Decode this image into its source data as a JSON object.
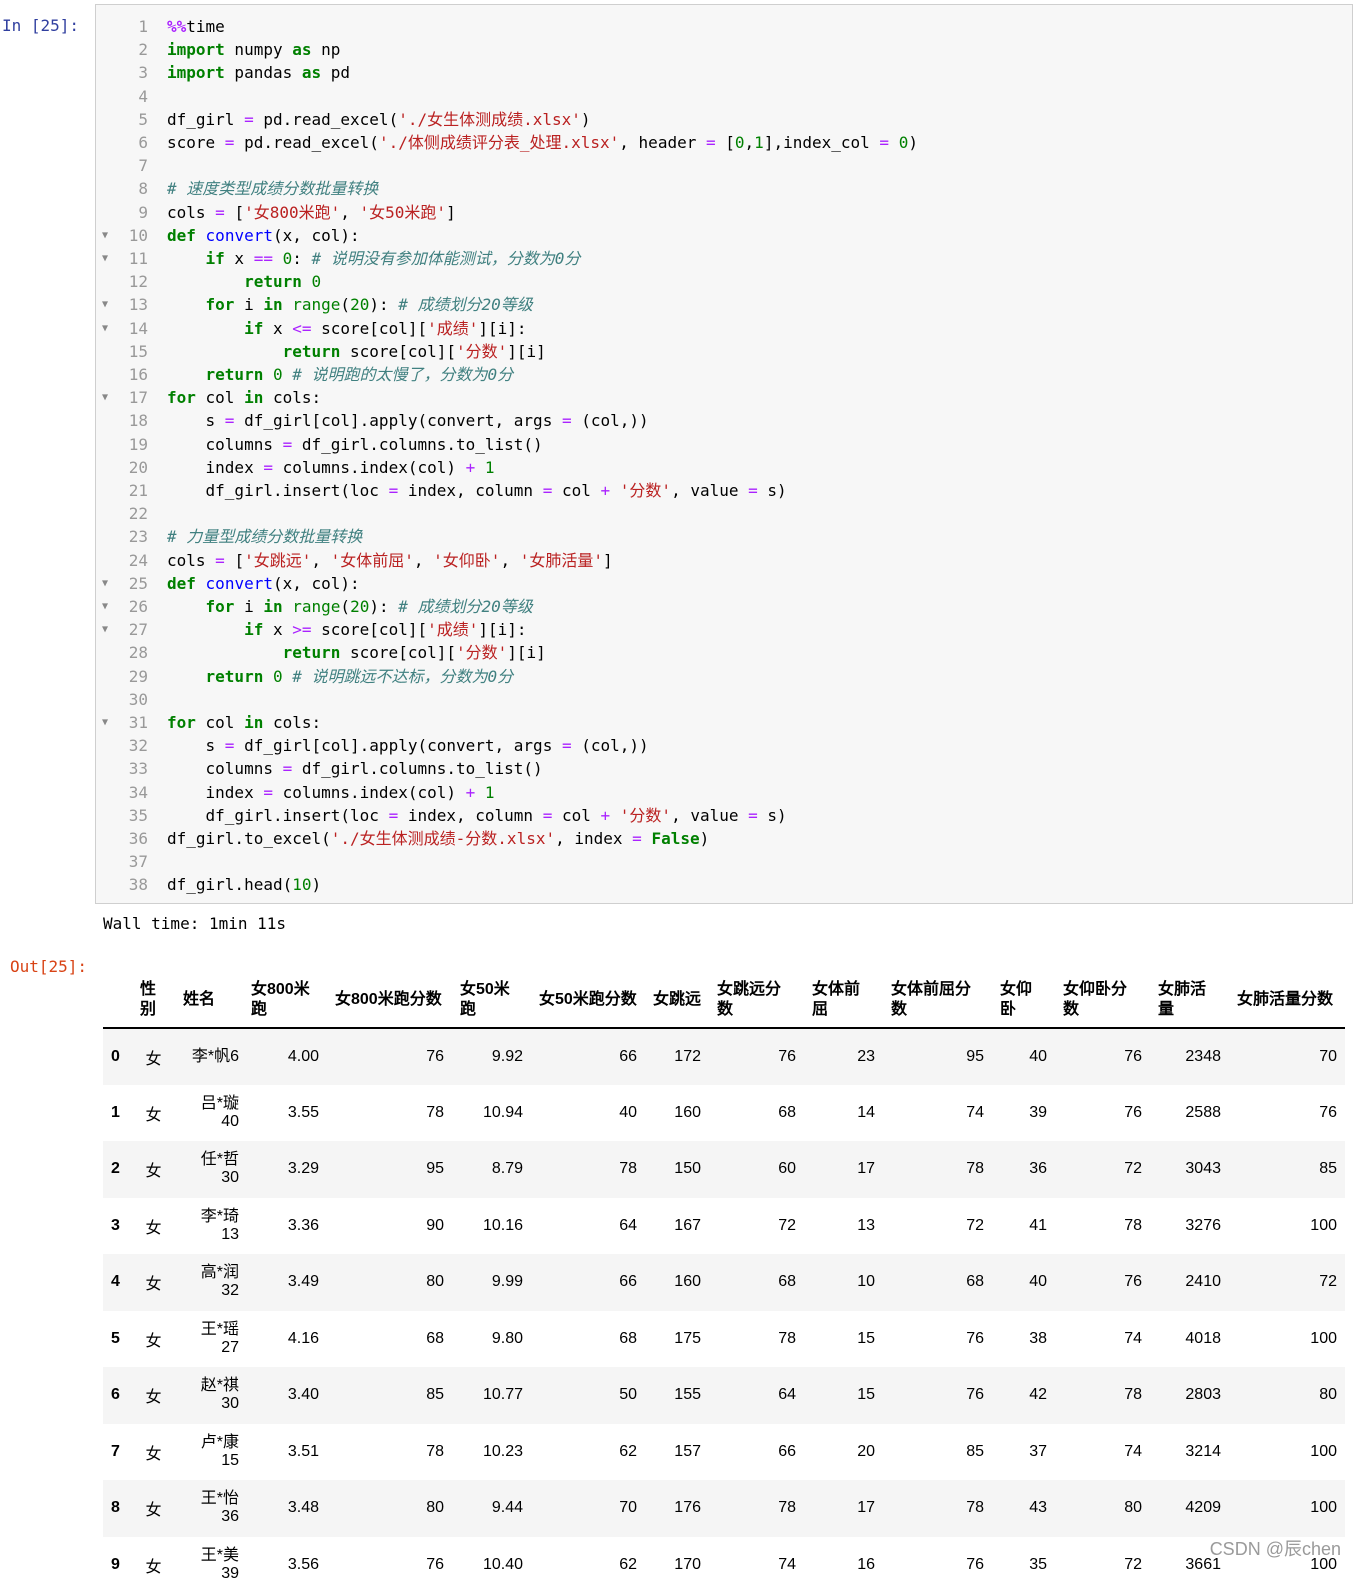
{
  "prompts": {
    "input": "In  [25]:",
    "output": "Out[25]:"
  },
  "code_lines": [
    {
      "n": "1",
      "fold": false,
      "t": [
        [
          "mg",
          "%%"
        ],
        [
          "",
          "time"
        ]
      ]
    },
    {
      "n": "2",
      "fold": false,
      "t": [
        [
          "kw",
          "import"
        ],
        [
          "",
          " numpy "
        ],
        [
          "kw",
          "as"
        ],
        [
          "",
          " np"
        ]
      ]
    },
    {
      "n": "3",
      "fold": false,
      "t": [
        [
          "kw",
          "import"
        ],
        [
          "",
          " pandas "
        ],
        [
          "kw",
          "as"
        ],
        [
          "",
          " pd"
        ]
      ]
    },
    {
      "n": "4",
      "fold": false,
      "t": []
    },
    {
      "n": "5",
      "fold": false,
      "t": [
        [
          "",
          "df_girl "
        ],
        [
          "op",
          "="
        ],
        [
          "",
          " pd.read_excel("
        ],
        [
          "str",
          "'./女生体测成绩.xlsx'"
        ],
        [
          "",
          ")"
        ]
      ]
    },
    {
      "n": "6",
      "fold": false,
      "t": [
        [
          "",
          "score "
        ],
        [
          "op",
          "="
        ],
        [
          "",
          " pd.read_excel("
        ],
        [
          "str",
          "'./体侧成绩评分表_处理.xlsx'"
        ],
        [
          "",
          ", header "
        ],
        [
          "op",
          "="
        ],
        [
          "",
          " ["
        ],
        [
          "num",
          "0"
        ],
        [
          "",
          ","
        ],
        [
          "num",
          "1"
        ],
        [
          "",
          "],index_col "
        ],
        [
          "op",
          "="
        ],
        [
          "",
          " "
        ],
        [
          "num",
          "0"
        ],
        [
          "",
          ")"
        ]
      ]
    },
    {
      "n": "7",
      "fold": false,
      "t": []
    },
    {
      "n": "8",
      "fold": false,
      "t": [
        [
          "com",
          "# 速度类型成绩分数批量转换"
        ]
      ]
    },
    {
      "n": "9",
      "fold": false,
      "t": [
        [
          "",
          "cols "
        ],
        [
          "op",
          "="
        ],
        [
          "",
          " ["
        ],
        [
          "str",
          "'女800米跑'"
        ],
        [
          "",
          ", "
        ],
        [
          "str",
          "'女50米跑'"
        ],
        [
          "",
          "]"
        ]
      ]
    },
    {
      "n": "10",
      "fold": true,
      "t": [
        [
          "kw",
          "def"
        ],
        [
          "",
          " "
        ],
        [
          "fn",
          "convert"
        ],
        [
          "",
          "(x, col):"
        ]
      ]
    },
    {
      "n": "11",
      "fold": true,
      "t": [
        [
          "",
          "    "
        ],
        [
          "kw",
          "if"
        ],
        [
          "",
          " x "
        ],
        [
          "op",
          "=="
        ],
        [
          "",
          " "
        ],
        [
          "num",
          "0"
        ],
        [
          "",
          ": "
        ],
        [
          "com",
          "# 说明没有参加体能测试，分数为0分"
        ]
      ]
    },
    {
      "n": "12",
      "fold": false,
      "t": [
        [
          "",
          "        "
        ],
        [
          "kw",
          "return"
        ],
        [
          "",
          " "
        ],
        [
          "num",
          "0"
        ]
      ]
    },
    {
      "n": "13",
      "fold": true,
      "t": [
        [
          "",
          "    "
        ],
        [
          "kw",
          "for"
        ],
        [
          "",
          " i "
        ],
        [
          "kw",
          "in"
        ],
        [
          "",
          " "
        ],
        [
          "num",
          "range"
        ],
        [
          "",
          "("
        ],
        [
          "num",
          "20"
        ],
        [
          "",
          "): "
        ],
        [
          "com",
          "# 成绩划分20等级"
        ]
      ]
    },
    {
      "n": "14",
      "fold": true,
      "t": [
        [
          "",
          "        "
        ],
        [
          "kw",
          "if"
        ],
        [
          "",
          " x "
        ],
        [
          "op",
          "<="
        ],
        [
          "",
          " score[col]["
        ],
        [
          "str",
          "'成绩'"
        ],
        [
          "",
          "][i]:"
        ]
      ]
    },
    {
      "n": "15",
      "fold": false,
      "t": [
        [
          "",
          "            "
        ],
        [
          "kw",
          "return"
        ],
        [
          "",
          " score[col]["
        ],
        [
          "str",
          "'分数'"
        ],
        [
          "",
          "][i]"
        ]
      ]
    },
    {
      "n": "16",
      "fold": false,
      "t": [
        [
          "",
          "    "
        ],
        [
          "kw",
          "return"
        ],
        [
          "",
          " "
        ],
        [
          "num",
          "0"
        ],
        [
          "",
          " "
        ],
        [
          "com",
          "# 说明跑的太慢了，分数为0分"
        ]
      ]
    },
    {
      "n": "17",
      "fold": true,
      "t": [
        [
          "kw",
          "for"
        ],
        [
          "",
          " col "
        ],
        [
          "kw",
          "in"
        ],
        [
          "",
          " cols:"
        ]
      ]
    },
    {
      "n": "18",
      "fold": false,
      "t": [
        [
          "",
          "    s "
        ],
        [
          "op",
          "="
        ],
        [
          "",
          " df_girl[col].apply(convert, args "
        ],
        [
          "op",
          "="
        ],
        [
          "",
          " (col,))"
        ]
      ]
    },
    {
      "n": "19",
      "fold": false,
      "t": [
        [
          "",
          "    columns "
        ],
        [
          "op",
          "="
        ],
        [
          "",
          " df_girl.columns.to_list()"
        ]
      ]
    },
    {
      "n": "20",
      "fold": false,
      "t": [
        [
          "",
          "    index "
        ],
        [
          "op",
          "="
        ],
        [
          "",
          " columns.index(col) "
        ],
        [
          "op",
          "+"
        ],
        [
          "",
          " "
        ],
        [
          "num",
          "1"
        ]
      ]
    },
    {
      "n": "21",
      "fold": false,
      "t": [
        [
          "",
          "    df_girl.insert(loc "
        ],
        [
          "op",
          "="
        ],
        [
          "",
          " index, column "
        ],
        [
          "op",
          "="
        ],
        [
          "",
          " col "
        ],
        [
          "op",
          "+"
        ],
        [
          "",
          " "
        ],
        [
          "str",
          "'分数'"
        ],
        [
          "",
          ", value "
        ],
        [
          "op",
          "="
        ],
        [
          "",
          " s)"
        ]
      ]
    },
    {
      "n": "22",
      "fold": false,
      "t": []
    },
    {
      "n": "23",
      "fold": false,
      "t": [
        [
          "com",
          "# 力量型成绩分数批量转换"
        ]
      ]
    },
    {
      "n": "24",
      "fold": false,
      "t": [
        [
          "",
          "cols "
        ],
        [
          "op",
          "="
        ],
        [
          "",
          " ["
        ],
        [
          "str",
          "'女跳远'"
        ],
        [
          "",
          ", "
        ],
        [
          "str",
          "'女体前屈'"
        ],
        [
          "",
          ", "
        ],
        [
          "str",
          "'女仰卧'"
        ],
        [
          "",
          ", "
        ],
        [
          "str",
          "'女肺活量'"
        ],
        [
          "",
          "]"
        ]
      ]
    },
    {
      "n": "25",
      "fold": true,
      "t": [
        [
          "kw",
          "def"
        ],
        [
          "",
          " "
        ],
        [
          "fn",
          "convert"
        ],
        [
          "",
          "(x, col):"
        ]
      ]
    },
    {
      "n": "26",
      "fold": true,
      "t": [
        [
          "",
          "    "
        ],
        [
          "kw",
          "for"
        ],
        [
          "",
          " i "
        ],
        [
          "kw",
          "in"
        ],
        [
          "",
          " "
        ],
        [
          "num",
          "range"
        ],
        [
          "",
          "("
        ],
        [
          "num",
          "20"
        ],
        [
          "",
          "): "
        ],
        [
          "com",
          "# 成绩划分20等级"
        ]
      ]
    },
    {
      "n": "27",
      "fold": true,
      "t": [
        [
          "",
          "        "
        ],
        [
          "kw",
          "if"
        ],
        [
          "",
          " x "
        ],
        [
          "op",
          ">="
        ],
        [
          "",
          " score[col]["
        ],
        [
          "str",
          "'成绩'"
        ],
        [
          "",
          "][i]:"
        ]
      ]
    },
    {
      "n": "28",
      "fold": false,
      "t": [
        [
          "",
          "            "
        ],
        [
          "kw",
          "return"
        ],
        [
          "",
          " score[col]["
        ],
        [
          "str",
          "'分数'"
        ],
        [
          "",
          "][i]"
        ]
      ]
    },
    {
      "n": "29",
      "fold": false,
      "t": [
        [
          "",
          "    "
        ],
        [
          "kw",
          "return"
        ],
        [
          "",
          " "
        ],
        [
          "num",
          "0"
        ],
        [
          "",
          " "
        ],
        [
          "com",
          "# 说明跳远不达标，分数为0分"
        ]
      ]
    },
    {
      "n": "30",
      "fold": false,
      "t": []
    },
    {
      "n": "31",
      "fold": true,
      "t": [
        [
          "kw",
          "for"
        ],
        [
          "",
          " col "
        ],
        [
          "kw",
          "in"
        ],
        [
          "",
          " cols:"
        ]
      ]
    },
    {
      "n": "32",
      "fold": false,
      "t": [
        [
          "",
          "    s "
        ],
        [
          "op",
          "="
        ],
        [
          "",
          " df_girl[col].apply(convert, args "
        ],
        [
          "op",
          "="
        ],
        [
          "",
          " (col,))"
        ]
      ]
    },
    {
      "n": "33",
      "fold": false,
      "t": [
        [
          "",
          "    columns "
        ],
        [
          "op",
          "="
        ],
        [
          "",
          " df_girl.columns.to_list()"
        ]
      ]
    },
    {
      "n": "34",
      "fold": false,
      "t": [
        [
          "",
          "    index "
        ],
        [
          "op",
          "="
        ],
        [
          "",
          " columns.index(col) "
        ],
        [
          "op",
          "+"
        ],
        [
          "",
          " "
        ],
        [
          "num",
          "1"
        ]
      ]
    },
    {
      "n": "35",
      "fold": false,
      "t": [
        [
          "",
          "    df_girl.insert(loc "
        ],
        [
          "op",
          "="
        ],
        [
          "",
          " index, column "
        ],
        [
          "op",
          "="
        ],
        [
          "",
          " col "
        ],
        [
          "op",
          "+"
        ],
        [
          "",
          " "
        ],
        [
          "str",
          "'分数'"
        ],
        [
          "",
          ", value "
        ],
        [
          "op",
          "="
        ],
        [
          "",
          " s)"
        ]
      ]
    },
    {
      "n": "36",
      "fold": false,
      "t": [
        [
          "",
          "df_girl.to_excel("
        ],
        [
          "str",
          "'./女生体测成绩-分数.xlsx'"
        ],
        [
          "",
          ", index "
        ],
        [
          "op",
          "="
        ],
        [
          "",
          " "
        ],
        [
          "kw",
          "False"
        ],
        [
          "",
          ")"
        ]
      ]
    },
    {
      "n": "37",
      "fold": false,
      "t": []
    },
    {
      "n": "38",
      "fold": false,
      "t": [
        [
          "",
          "df_girl.head("
        ],
        [
          "num",
          "10"
        ],
        [
          "",
          ")"
        ]
      ]
    }
  ],
  "stdout": "Wall time: 1min 11s",
  "table": {
    "columns": [
      "性别",
      "姓名",
      "女800米跑",
      "女800米跑分数",
      "女50米跑",
      "女50米跑分数",
      "女跳远",
      "女跳远分数",
      "女体前屈",
      "女体前屈分数",
      "女仰卧",
      "女仰卧分数",
      "女肺活量",
      "女肺活量分数"
    ],
    "rows": [
      {
        "index": "0",
        "cells": [
          "女",
          "李*帆6",
          "4.00",
          "76",
          "9.92",
          "66",
          "172",
          "76",
          "23",
          "95",
          "40",
          "76",
          "2348",
          "70"
        ]
      },
      {
        "index": "1",
        "cells": [
          "女",
          "吕*璇40",
          "3.55",
          "78",
          "10.94",
          "40",
          "160",
          "68",
          "14",
          "74",
          "39",
          "76",
          "2588",
          "76"
        ]
      },
      {
        "index": "2",
        "cells": [
          "女",
          "任*哲30",
          "3.29",
          "95",
          "8.79",
          "78",
          "150",
          "60",
          "17",
          "78",
          "36",
          "72",
          "3043",
          "85"
        ]
      },
      {
        "index": "3",
        "cells": [
          "女",
          "李*琦13",
          "3.36",
          "90",
          "10.16",
          "64",
          "167",
          "72",
          "13",
          "72",
          "41",
          "78",
          "3276",
          "100"
        ]
      },
      {
        "index": "4",
        "cells": [
          "女",
          "高*润32",
          "3.49",
          "80",
          "9.99",
          "66",
          "160",
          "68",
          "10",
          "68",
          "40",
          "76",
          "2410",
          "72"
        ]
      },
      {
        "index": "5",
        "cells": [
          "女",
          "王*瑶27",
          "4.16",
          "68",
          "9.80",
          "68",
          "175",
          "78",
          "15",
          "76",
          "38",
          "74",
          "4018",
          "100"
        ]
      },
      {
        "index": "6",
        "cells": [
          "女",
          "赵*祺30",
          "3.40",
          "85",
          "10.77",
          "50",
          "155",
          "64",
          "15",
          "76",
          "42",
          "78",
          "2803",
          "80"
        ]
      },
      {
        "index": "7",
        "cells": [
          "女",
          "卢*康15",
          "3.51",
          "78",
          "10.23",
          "62",
          "157",
          "66",
          "20",
          "85",
          "37",
          "74",
          "3214",
          "100"
        ]
      },
      {
        "index": "8",
        "cells": [
          "女",
          "王*怡36",
          "3.48",
          "80",
          "9.44",
          "70",
          "176",
          "78",
          "17",
          "78",
          "43",
          "80",
          "4209",
          "100"
        ]
      },
      {
        "index": "9",
        "cells": [
          "女",
          "王*美39",
          "3.56",
          "76",
          "10.40",
          "62",
          "170",
          "74",
          "16",
          "76",
          "35",
          "72",
          "3661",
          "100"
        ]
      }
    ]
  },
  "watermark": "CSDN @辰chen"
}
